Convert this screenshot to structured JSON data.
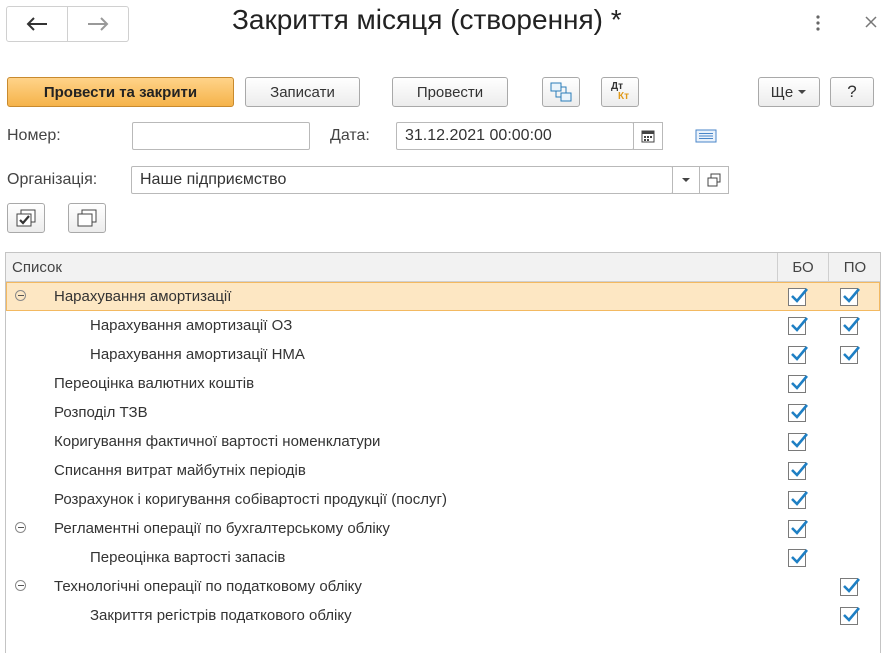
{
  "window": {
    "title": "Закриття місяця (створення) *",
    "back_icon": "arrow-left-icon",
    "forward_icon": "arrow-right-icon",
    "more_icon": "kebab-icon",
    "close_icon": "close-icon"
  },
  "toolbar": {
    "post_and_close": "Провести та закрити",
    "save": "Записати",
    "post": "Провести",
    "more": "Ще",
    "help": "?",
    "structure_icon": "structure-icon",
    "dtkt_icon": "dt-kt-icon",
    "dt_label": "Дт",
    "kt_label": "Кт"
  },
  "header": {
    "number_label": "Номер:",
    "number_value": "",
    "date_label": "Дата:",
    "date_value": "31.12.2021 00:00:00",
    "org_label": "Організація:",
    "org_value": "Наше підприємство"
  },
  "list": {
    "col_name": "Список",
    "col_bo": "БО",
    "col_po": "ПО",
    "rows": [
      {
        "label": "Нарахування амортизації",
        "level": 0,
        "group": true,
        "bo": true,
        "po": true,
        "selected": true
      },
      {
        "label": "Нарахування амортизації ОЗ",
        "level": 1,
        "group": false,
        "bo": true,
        "po": true
      },
      {
        "label": "Нарахування амортизації НМА",
        "level": 1,
        "group": false,
        "bo": true,
        "po": true
      },
      {
        "label": "Переоцінка валютних коштів",
        "level": 0,
        "group": false,
        "bo": true,
        "po": null
      },
      {
        "label": "Розподіл ТЗВ",
        "level": 0,
        "group": false,
        "bo": true,
        "po": null
      },
      {
        "label": "Коригування фактичної вартості номенклатури",
        "level": 0,
        "group": false,
        "bo": true,
        "po": null
      },
      {
        "label": "Списання витрат майбутніх періодів",
        "level": 0,
        "group": false,
        "bo": true,
        "po": null
      },
      {
        "label": "Розрахунок і коригування собівартості продукції (послуг)",
        "level": 0,
        "group": false,
        "bo": true,
        "po": null
      },
      {
        "label": "Регламентні операції по бухгалтерському обліку",
        "level": 0,
        "group": true,
        "bo": true,
        "po": null
      },
      {
        "label": "Переоцінка вартості запасів",
        "level": 1,
        "group": false,
        "bo": true,
        "po": null
      },
      {
        "label": "Технологічні операції по податковому обліку",
        "level": 0,
        "group": true,
        "bo": null,
        "po": true
      },
      {
        "label": "Закриття регістрів податкового обліку",
        "level": 1,
        "group": false,
        "bo": null,
        "po": true
      }
    ]
  },
  "colors": {
    "accent": "#f5b34a",
    "selected_row": "#fde7c3",
    "checkmark": "#1e7fc4"
  }
}
